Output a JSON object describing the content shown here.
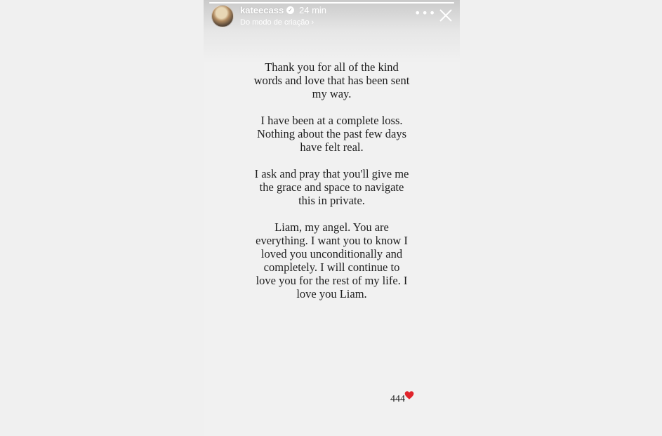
{
  "header": {
    "username": "kateecass",
    "verified_icon": "verified-badge-icon",
    "time": "24 min",
    "subtitle": "Do modo de criação ›",
    "more_icon": "more-horizontal-icon",
    "close_icon": "close-icon",
    "progress": 1.0
  },
  "story": {
    "paragraphs": [
      "Thank you for all of the kind words and love that has been sent my way.",
      "I have been at a complete loss. Nothing about the past few days have felt real.",
      "I ask and pray that you'll give me the grace and space to navigate this in private.",
      "Liam, my angel. You are everything. I want you to know I loved you unconditionally and completely. I will continue to love you for the rest of my life. I love you Liam."
    ],
    "footer_text": "444",
    "footer_icon": "heart-icon"
  },
  "colors": {
    "heart": "#e0242b",
    "text": "#1e1e1e",
    "background": "#f1f1f1"
  }
}
